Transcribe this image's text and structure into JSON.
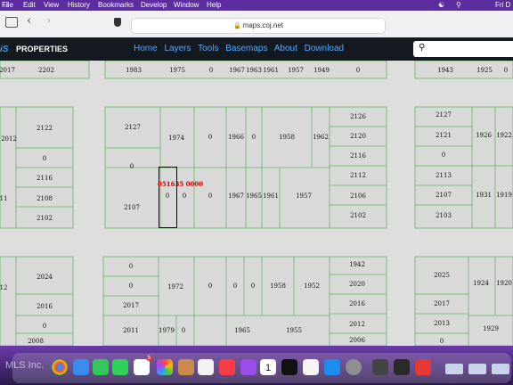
{
  "menubar": {
    "items": [
      "File",
      "Edit",
      "View",
      "History",
      "Bookmarks",
      "Develop",
      "Window",
      "Help"
    ],
    "clock": "Fri D"
  },
  "browser": {
    "url": "maps.coj.net"
  },
  "app": {
    "brand": "PROPERTIES",
    "logo_text": "iS",
    "nav": [
      "Home",
      "Layers",
      "Tools",
      "Basemaps",
      "About",
      "Download"
    ]
  },
  "map": {
    "selected_parcel_id": "051635 0000",
    "parcels": [
      {
        "id": "p1",
        "label": "2017"
      },
      {
        "id": "p2",
        "label": "2202"
      },
      {
        "id": "p3",
        "label": "1983"
      },
      {
        "id": "p4",
        "label": "1975"
      },
      {
        "id": "p5",
        "label": "0"
      },
      {
        "id": "p6",
        "label": "1967"
      },
      {
        "id": "p7",
        "label": "1963"
      },
      {
        "id": "p8",
        "label": "1961"
      },
      {
        "id": "p9",
        "label": "1957"
      },
      {
        "id": "p10",
        "label": "1949"
      },
      {
        "id": "p11",
        "label": "0"
      },
      {
        "id": "p12",
        "label": "1943"
      },
      {
        "id": "p13",
        "label": "1925"
      },
      {
        "id": "p14",
        "label": "0"
      },
      {
        "id": "p15",
        "label": "2122"
      },
      {
        "id": "p16",
        "label": "2012"
      },
      {
        "id": "p17",
        "label": "0"
      },
      {
        "id": "p18",
        "label": "2116"
      },
      {
        "id": "p19",
        "label": "11"
      },
      {
        "id": "p20",
        "label": "2108"
      },
      {
        "id": "p21",
        "label": "2102"
      },
      {
        "id": "p22",
        "label": "2127"
      },
      {
        "id": "p23",
        "label": "1974"
      },
      {
        "id": "p24",
        "label": "0"
      },
      {
        "id": "p25",
        "label": "1966"
      },
      {
        "id": "p26",
        "label": "0"
      },
      {
        "id": "p27",
        "label": "1958"
      },
      {
        "id": "p28",
        "label": "1962"
      },
      {
        "id": "p29",
        "label": "2126"
      },
      {
        "id": "p30",
        "label": "2120"
      },
      {
        "id": "p31",
        "label": "2116"
      },
      {
        "id": "p32",
        "label": "2112"
      },
      {
        "id": "p33",
        "label": "2106"
      },
      {
        "id": "p34",
        "label": "2102"
      },
      {
        "id": "p35",
        "label": "0"
      },
      {
        "id": "p36",
        "label": "2107"
      },
      {
        "id": "p37",
        "label": "0"
      },
      {
        "id": "p38",
        "label": "0"
      },
      {
        "id": "p39",
        "label": "0"
      },
      {
        "id": "p40",
        "label": "1967"
      },
      {
        "id": "p41",
        "label": "1965"
      },
      {
        "id": "p42",
        "label": "1961"
      },
      {
        "id": "p43",
        "label": "1957"
      },
      {
        "id": "p44",
        "label": "2127"
      },
      {
        "id": "p45",
        "label": "2121"
      },
      {
        "id": "p46",
        "label": "1926"
      },
      {
        "id": "p47",
        "label": "1922"
      },
      {
        "id": "p48",
        "label": "0"
      },
      {
        "id": "p49",
        "label": "2113"
      },
      {
        "id": "p50",
        "label": "2107"
      },
      {
        "id": "p51",
        "label": "1931"
      },
      {
        "id": "p52",
        "label": "1919"
      },
      {
        "id": "p53",
        "label": "2103"
      },
      {
        "id": "p54",
        "label": "2024"
      },
      {
        "id": "p55",
        "label": "12"
      },
      {
        "id": "p56",
        "label": "2016"
      },
      {
        "id": "p57",
        "label": "0"
      },
      {
        "id": "p58",
        "label": "2008"
      },
      {
        "id": "p59",
        "label": "0"
      },
      {
        "id": "p60",
        "label": "0"
      },
      {
        "id": "p61",
        "label": "2017"
      },
      {
        "id": "p62",
        "label": "2011"
      },
      {
        "id": "p63",
        "label": "1972"
      },
      {
        "id": "p64",
        "label": "1979"
      },
      {
        "id": "p65",
        "label": "0"
      },
      {
        "id": "p66",
        "label": "0"
      },
      {
        "id": "p67",
        "label": "0"
      },
      {
        "id": "p68",
        "label": "0"
      },
      {
        "id": "p69",
        "label": "1958"
      },
      {
        "id": "p70",
        "label": "1952"
      },
      {
        "id": "p71",
        "label": "1965"
      },
      {
        "id": "p72",
        "label": "1955"
      },
      {
        "id": "p73",
        "label": "1942"
      },
      {
        "id": "p74",
        "label": "2020"
      },
      {
        "id": "p75",
        "label": "2016"
      },
      {
        "id": "p76",
        "label": "2012"
      },
      {
        "id": "p77",
        "label": "2006"
      },
      {
        "id": "p78",
        "label": "2025"
      },
      {
        "id": "p79",
        "label": "1924"
      },
      {
        "id": "p80",
        "label": "1920"
      },
      {
        "id": "p81",
        "label": "2017"
      },
      {
        "id": "p82",
        "label": "2013"
      },
      {
        "id": "p83",
        "label": "1929"
      },
      {
        "id": "p84",
        "label": "0"
      }
    ]
  },
  "dock": {
    "watermark": "MLS Inc.",
    "calendar_day": "1",
    "badge": "5"
  },
  "icons": [
    "wifi-icon",
    "search-icon",
    "back-icon",
    "forward-icon",
    "shield-icon",
    "sidebar-icon"
  ]
}
